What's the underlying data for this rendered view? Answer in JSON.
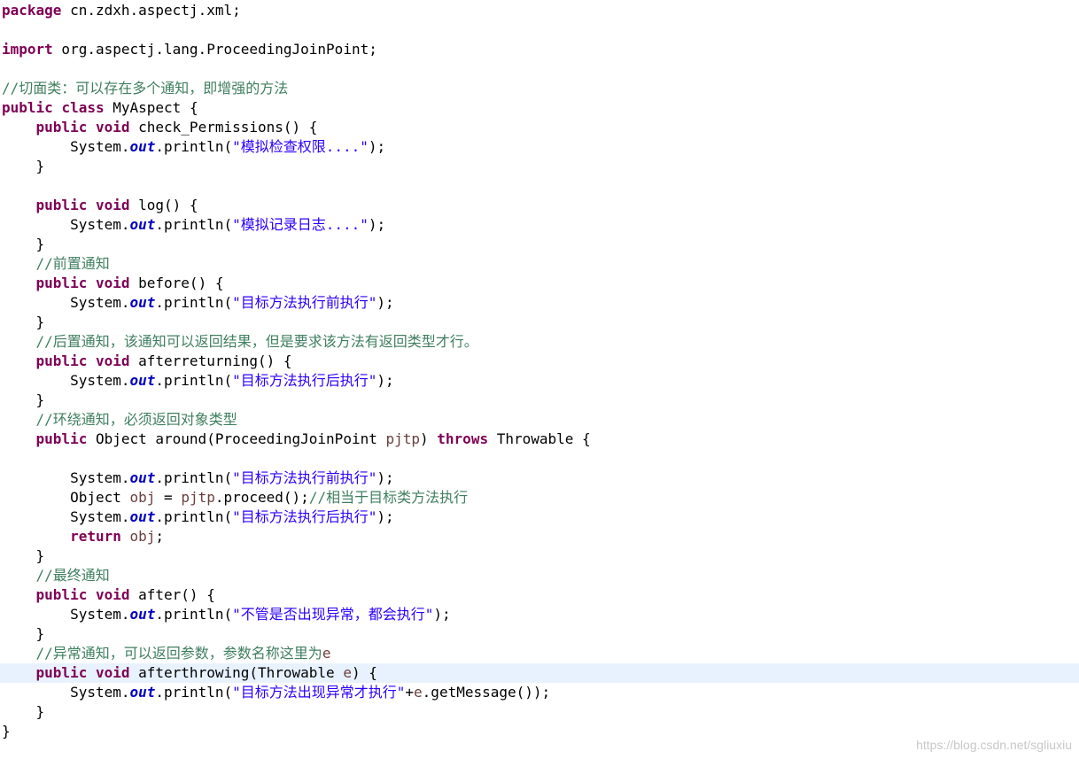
{
  "editor": {
    "lines": [
      {
        "tokens": [
          {
            "t": "kw",
            "v": "package"
          },
          {
            "t": "plain",
            "v": " cn.zdxh.aspectj.xml;"
          }
        ]
      },
      {
        "tokens": []
      },
      {
        "tokens": [
          {
            "t": "kw",
            "v": "import"
          },
          {
            "t": "plain",
            "v": " org.aspectj.lang.ProceedingJoinPoint;"
          }
        ]
      },
      {
        "tokens": []
      },
      {
        "tokens": [
          {
            "t": "cmt",
            "v": "//切面类：可以存在多个通知，即增强的方法"
          }
        ]
      },
      {
        "tokens": [
          {
            "t": "kw",
            "v": "public"
          },
          {
            "t": "plain",
            "v": " "
          },
          {
            "t": "kw",
            "v": "class"
          },
          {
            "t": "plain",
            "v": " MyAspect {"
          }
        ]
      },
      {
        "tokens": [
          {
            "t": "plain",
            "v": "    "
          },
          {
            "t": "kw",
            "v": "public"
          },
          {
            "t": "plain",
            "v": " "
          },
          {
            "t": "kw",
            "v": "void"
          },
          {
            "t": "plain",
            "v": " check_Permissions() {"
          }
        ]
      },
      {
        "tokens": [
          {
            "t": "plain",
            "v": "        System."
          },
          {
            "t": "fld",
            "v": "out"
          },
          {
            "t": "plain",
            "v": ".println("
          },
          {
            "t": "str",
            "v": "\"模拟检查权限....\""
          },
          {
            "t": "plain",
            "v": ");"
          }
        ]
      },
      {
        "tokens": [
          {
            "t": "plain",
            "v": "    }"
          }
        ]
      },
      {
        "tokens": []
      },
      {
        "tokens": [
          {
            "t": "plain",
            "v": "    "
          },
          {
            "t": "kw",
            "v": "public"
          },
          {
            "t": "plain",
            "v": " "
          },
          {
            "t": "kw",
            "v": "void"
          },
          {
            "t": "plain",
            "v": " log() {"
          }
        ]
      },
      {
        "tokens": [
          {
            "t": "plain",
            "v": "        System."
          },
          {
            "t": "fld",
            "v": "out"
          },
          {
            "t": "plain",
            "v": ".println("
          },
          {
            "t": "str",
            "v": "\"模拟记录日志....\""
          },
          {
            "t": "plain",
            "v": ");"
          }
        ]
      },
      {
        "tokens": [
          {
            "t": "plain",
            "v": "    }"
          }
        ]
      },
      {
        "tokens": [
          {
            "t": "plain",
            "v": "    "
          },
          {
            "t": "cmt",
            "v": "//前置通知"
          }
        ]
      },
      {
        "tokens": [
          {
            "t": "plain",
            "v": "    "
          },
          {
            "t": "kw",
            "v": "public"
          },
          {
            "t": "plain",
            "v": " "
          },
          {
            "t": "kw",
            "v": "void"
          },
          {
            "t": "plain",
            "v": " before() {"
          }
        ]
      },
      {
        "tokens": [
          {
            "t": "plain",
            "v": "        System."
          },
          {
            "t": "fld",
            "v": "out"
          },
          {
            "t": "plain",
            "v": ".println("
          },
          {
            "t": "str",
            "v": "\"目标方法执行前执行\""
          },
          {
            "t": "plain",
            "v": ");"
          }
        ]
      },
      {
        "tokens": [
          {
            "t": "plain",
            "v": "    }"
          }
        ]
      },
      {
        "tokens": [
          {
            "t": "plain",
            "v": "    "
          },
          {
            "t": "cmt",
            "v": "//后置通知，该通知可以返回结果，但是要求该方法有返回类型才行。"
          }
        ]
      },
      {
        "tokens": [
          {
            "t": "plain",
            "v": "    "
          },
          {
            "t": "kw",
            "v": "public"
          },
          {
            "t": "plain",
            "v": " "
          },
          {
            "t": "kw",
            "v": "void"
          },
          {
            "t": "plain",
            "v": " afterreturning() {"
          }
        ]
      },
      {
        "tokens": [
          {
            "t": "plain",
            "v": "        System."
          },
          {
            "t": "fld",
            "v": "out"
          },
          {
            "t": "plain",
            "v": ".println("
          },
          {
            "t": "str",
            "v": "\"目标方法执行后执行\""
          },
          {
            "t": "plain",
            "v": ");"
          }
        ]
      },
      {
        "tokens": [
          {
            "t": "plain",
            "v": "    }"
          }
        ]
      },
      {
        "tokens": [
          {
            "t": "plain",
            "v": "    "
          },
          {
            "t": "cmt",
            "v": "//环绕通知，必须返回对象类型"
          }
        ]
      },
      {
        "tokens": [
          {
            "t": "plain",
            "v": "    "
          },
          {
            "t": "kw",
            "v": "public"
          },
          {
            "t": "plain",
            "v": " Object around(ProceedingJoinPoint "
          },
          {
            "t": "var",
            "v": "pjtp"
          },
          {
            "t": "plain",
            "v": ") "
          },
          {
            "t": "kw",
            "v": "throws"
          },
          {
            "t": "plain",
            "v": " Throwable {"
          }
        ]
      },
      {
        "tokens": []
      },
      {
        "tokens": [
          {
            "t": "plain",
            "v": "        System."
          },
          {
            "t": "fld",
            "v": "out"
          },
          {
            "t": "plain",
            "v": ".println("
          },
          {
            "t": "str",
            "v": "\"目标方法执行前执行\""
          },
          {
            "t": "plain",
            "v": ");"
          }
        ]
      },
      {
        "tokens": [
          {
            "t": "plain",
            "v": "        Object "
          },
          {
            "t": "var",
            "v": "obj"
          },
          {
            "t": "plain",
            "v": " = "
          },
          {
            "t": "var",
            "v": "pjtp"
          },
          {
            "t": "plain",
            "v": ".proceed();"
          },
          {
            "t": "cmt",
            "v": "//相当于目标类方法执行"
          }
        ]
      },
      {
        "tokens": [
          {
            "t": "plain",
            "v": "        System."
          },
          {
            "t": "fld",
            "v": "out"
          },
          {
            "t": "plain",
            "v": ".println("
          },
          {
            "t": "str",
            "v": "\"目标方法执行后执行\""
          },
          {
            "t": "plain",
            "v": ");"
          }
        ]
      },
      {
        "tokens": [
          {
            "t": "plain",
            "v": "        "
          },
          {
            "t": "kw",
            "v": "return"
          },
          {
            "t": "plain",
            "v": " "
          },
          {
            "t": "var",
            "v": "obj"
          },
          {
            "t": "plain",
            "v": ";"
          }
        ]
      },
      {
        "tokens": [
          {
            "t": "plain",
            "v": "    }"
          }
        ]
      },
      {
        "tokens": [
          {
            "t": "plain",
            "v": "    "
          },
          {
            "t": "cmt",
            "v": "//最终通知"
          }
        ]
      },
      {
        "tokens": [
          {
            "t": "plain",
            "v": "    "
          },
          {
            "t": "kw",
            "v": "public"
          },
          {
            "t": "plain",
            "v": " "
          },
          {
            "t": "kw",
            "v": "void"
          },
          {
            "t": "plain",
            "v": " after() {"
          }
        ]
      },
      {
        "tokens": [
          {
            "t": "plain",
            "v": "        System."
          },
          {
            "t": "fld",
            "v": "out"
          },
          {
            "t": "plain",
            "v": ".println("
          },
          {
            "t": "str",
            "v": "\"不管是否出现异常，都会执行\""
          },
          {
            "t": "plain",
            "v": ");"
          }
        ]
      },
      {
        "tokens": [
          {
            "t": "plain",
            "v": "    }"
          }
        ]
      },
      {
        "tokens": [
          {
            "t": "plain",
            "v": "    "
          },
          {
            "t": "cmt",
            "v": "//异常通知，可以返回参数，参数名称这里为"
          },
          {
            "t": "var",
            "v": "e"
          }
        ]
      },
      {
        "tokens": [
          {
            "t": "plain",
            "v": "    "
          },
          {
            "t": "kw",
            "v": "public"
          },
          {
            "t": "plain",
            "v": " "
          },
          {
            "t": "kw",
            "v": "void"
          },
          {
            "t": "plain",
            "v": " afterthrowing(Throwable "
          },
          {
            "t": "var",
            "v": "e"
          },
          {
            "t": "plain",
            "v": ") {"
          }
        ],
        "current": true
      },
      {
        "tokens": [
          {
            "t": "plain",
            "v": "        System."
          },
          {
            "t": "fld",
            "v": "out"
          },
          {
            "t": "plain",
            "v": ".println("
          },
          {
            "t": "str",
            "v": "\"目标方法出现异常才执行\""
          },
          {
            "t": "plain",
            "v": "+"
          },
          {
            "t": "var",
            "v": "e"
          },
          {
            "t": "plain",
            "v": ".getMessage());"
          }
        ]
      },
      {
        "tokens": [
          {
            "t": "plain",
            "v": "    }"
          }
        ]
      },
      {
        "tokens": [
          {
            "t": "plain",
            "v": "}"
          }
        ]
      }
    ]
  },
  "watermark": "https://blog.csdn.net/sgliuxiu",
  "colors": {
    "keyword": "#7f0055",
    "string": "#2a00ff",
    "comment": "#3f7f5f",
    "field": "#0000c0",
    "variable": "#6a3e3e",
    "current_line": "#e8f2fe"
  }
}
